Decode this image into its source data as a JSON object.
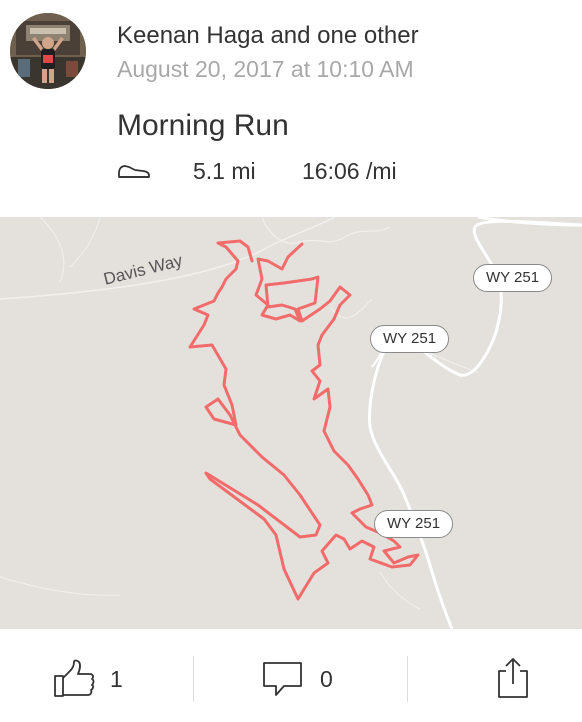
{
  "activity": {
    "athlete_line": "Keenan Haga and one other",
    "date": "August 20, 2017 at 10:10 AM",
    "title": "Morning Run",
    "activity_icon": "shoe-icon",
    "distance": "5.1 mi",
    "pace": "16:06 /mi"
  },
  "map": {
    "road_label": "Davis Way",
    "shields": [
      "WY 251",
      "WY 251",
      "WY 251"
    ],
    "route_color": "#f26b6b",
    "background_color": "#e4e1dd",
    "road_color": "#ffffff"
  },
  "actions": {
    "kudos_icon": "thumbs-up-icon",
    "kudos_count": "1",
    "comment_icon": "comment-icon",
    "comment_count": "0",
    "share_icon": "share-icon"
  }
}
